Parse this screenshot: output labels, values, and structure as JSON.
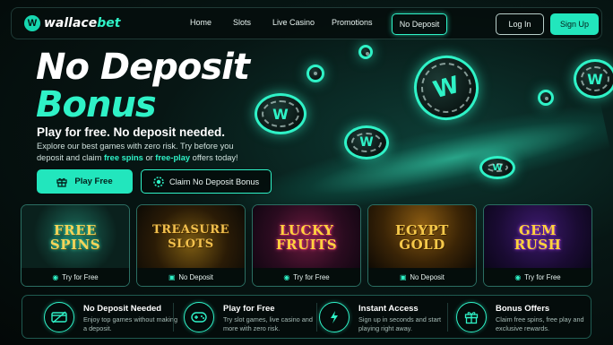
{
  "brand": {
    "name_part1": "wallace",
    "name_part2": "bet",
    "mark": "W"
  },
  "nav": {
    "links": [
      "Home",
      "Slots",
      "Live Casino",
      "Promotions"
    ],
    "active": "No Deposit",
    "login": "Log In",
    "signup": "Sign Up"
  },
  "hero": {
    "title_line1": "No Deposit",
    "title_line2": "Bonus",
    "subtitle": "Play for free. No deposit needed.",
    "desc_part1": "Explore our best games with zero risk. Try before you deposit and claim ",
    "desc_hl1": "free spins",
    "desc_part2": " or ",
    "desc_hl2": "free-play",
    "desc_part3": " offers today!",
    "btn_play": "Play Free",
    "btn_claim": "Claim No Deposit Bonus",
    "chip_letter": "W"
  },
  "games": [
    {
      "title": "FREE\nSPINS",
      "tag": "Try for Free",
      "icon": "eye-icon"
    },
    {
      "title": "TREASURE\nSLOTS",
      "tag": "No Deposit",
      "icon": "gift-icon"
    },
    {
      "title": "LUCKY\nFRUITS",
      "tag": "Try for Free",
      "icon": "eye-icon"
    },
    {
      "title": "EGYPT\nGOLD",
      "tag": "No Deposit",
      "icon": "gift-icon"
    },
    {
      "title": "GEM\nRUSH",
      "tag": "Try for Free",
      "icon": "eye-icon"
    }
  ],
  "features": [
    {
      "title": "No Deposit Needed",
      "desc": "Enjoy top games without making a deposit.",
      "icon": "no-card-icon"
    },
    {
      "title": "Play for Free",
      "desc": "Try slot games, live casino and more with zero risk.",
      "icon": "gamepad-icon"
    },
    {
      "title": "Instant Access",
      "desc": "Sign up in seconds and start playing right away.",
      "icon": "lightning-icon"
    },
    {
      "title": "Bonus Offers",
      "desc": "Claim free spins, free play and exclusive rewards.",
      "icon": "gift-icon"
    }
  ],
  "colors": {
    "accent": "#2ff2c7",
    "button": "#22e6bd",
    "bg": "#071614"
  }
}
